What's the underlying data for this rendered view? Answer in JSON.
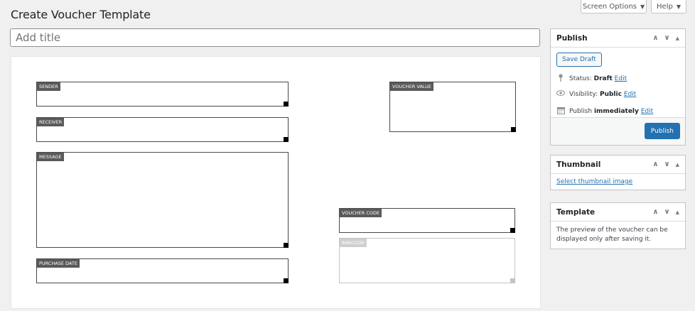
{
  "header": {
    "title": "Create Voucher Template",
    "screen_options": "Screen Options",
    "help": "Help",
    "caret": "▼"
  },
  "title_field": {
    "placeholder": "Add title",
    "value": ""
  },
  "voucher_fields": {
    "sender": "SENDER",
    "receiver": "RECEIVER",
    "message": "MESSAGE",
    "purchase_date": "PURCHASE DATE",
    "voucher_value": "VOUCHER VALUE",
    "voucher_code": "VOUCHER CODE",
    "barcode": "BARCODE"
  },
  "publish_panel": {
    "title": "Publish",
    "save_draft": "Save Draft",
    "status_label": "Status:",
    "status_value": "Draft",
    "visibility_label": "Visibility:",
    "visibility_value": "Public",
    "publish_label": "Publish",
    "publish_value": "immediately",
    "edit": "Edit",
    "publish_button": "Publish"
  },
  "thumbnail_panel": {
    "title": "Thumbnail",
    "link": "Select thumbnail image"
  },
  "template_panel": {
    "title": "Template",
    "text": "The preview of the voucher can be displayed only after saving it."
  },
  "panel_controls": {
    "up": "∧",
    "down": "∨",
    "toggle": "▲"
  },
  "icons": [
    "pin-icon",
    "eye-icon",
    "calendar-icon",
    "chevron-up-icon",
    "chevron-down-icon",
    "toggle-arrow-icon"
  ]
}
